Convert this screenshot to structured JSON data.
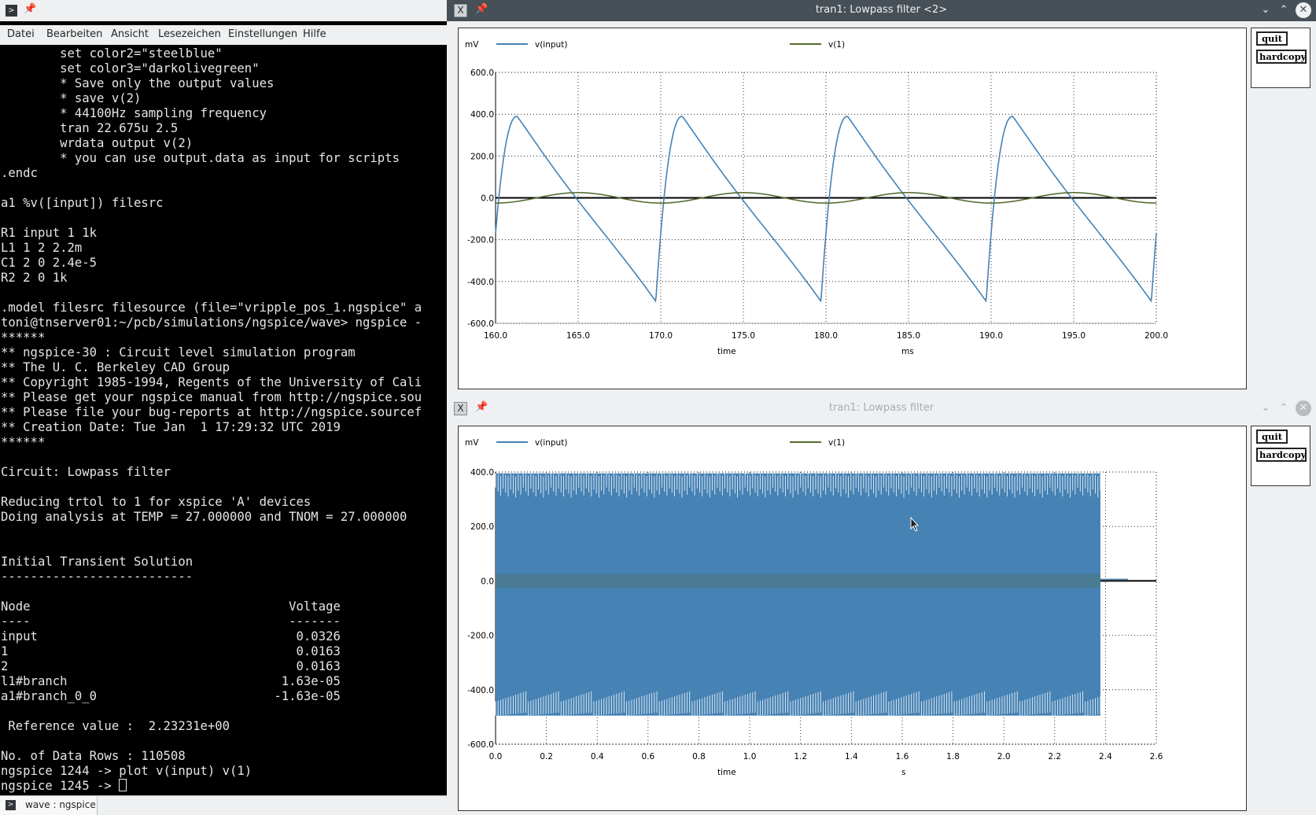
{
  "terminal": {
    "menu": [
      "Datei",
      "Bearbeiten",
      "Ansicht",
      "Lesezeichen",
      "Einstellungen",
      "Hilfe"
    ],
    "lines": [
      "        set color2=\"steelblue\"",
      "        set color3=\"darkolivegreen\"",
      "        * Save only the output values",
      "        * save v(2)",
      "        * 44100Hz sampling frequency",
      "        tran 22.675u 2.5",
      "        wrdata output v(2)",
      "        * you can use output.data as input for scripts",
      ".endc",
      "",
      "a1 %v([input]) filesrc",
      "",
      "R1 input 1 1k",
      "L1 1 2 2.2m",
      "C1 2 0 2.4e-5",
      "R2 2 0 1k",
      "",
      ".model filesrc filesource (file=\"vripple_pos_1.ngspice\" a",
      "toni@tnserver01:~/pcb/simulations/ngspice/wave> ngspice -",
      "******",
      "** ngspice-30 : Circuit level simulation program",
      "** The U. C. Berkeley CAD Group",
      "** Copyright 1985-1994, Regents of the University of Cali",
      "** Please get your ngspice manual from http://ngspice.sou",
      "** Please file your bug-reports at http://ngspice.sourcef",
      "** Creation Date: Tue Jan  1 17:29:32 UTC 2019",
      "******",
      "",
      "Circuit: Lowpass filter",
      "",
      "Reducing trtol to 1 for xspice 'A' devices",
      "Doing analysis at TEMP = 27.000000 and TNOM = 27.000000",
      "",
      "",
      "Initial Transient Solution",
      "--------------------------",
      "",
      "Node                                   Voltage",
      "----                                   -------",
      "input                                   0.0326",
      "1                                       0.0163",
      "2                                       0.0163",
      "l1#branch                             1.63e-05",
      "a1#branch_0_0                        -1.63e-05",
      "",
      " Reference value :  2.23231e+00",
      "",
      "No. of Data Rows : 110508",
      "ngspice 1244 -> plot v(input) v(1)",
      "ngspice 1245 -> "
    ],
    "tab_label": "wave : ngspice"
  },
  "plot1": {
    "title": "tran1: Lowpass filter <2>",
    "buttons": {
      "quit": "quit",
      "hardcopy": "hardcopy"
    },
    "unit": "mV",
    "xlabel": "time",
    "xunit": "ms",
    "legend": [
      "v(input)",
      "v(1)"
    ]
  },
  "plot2": {
    "title": "tran1: Lowpass filter",
    "buttons": {
      "quit": "quit",
      "hardcopy": "hardcopy"
    },
    "unit": "mV",
    "xlabel": "time",
    "xunit": "s",
    "legend": [
      "v(input)",
      "v(1)"
    ]
  },
  "colors": {
    "series1": "#4682b4",
    "series2": "#556b2f",
    "grid": "#000000",
    "titlebar_active": "#475057"
  },
  "chart_data": [
    {
      "type": "line",
      "title": "tran1: Lowpass filter <2>",
      "xlabel": "time",
      "xunit": "ms",
      "ylabel": "",
      "yunit": "mV",
      "xlim": [
        160.0,
        200.0
      ],
      "ylim": [
        -600.0,
        600.0
      ],
      "xticks": [
        "160.0",
        "165.0",
        "170.0",
        "175.0",
        "180.0",
        "185.0",
        "190.0",
        "195.0",
        "200.0"
      ],
      "yticks": [
        "600.0",
        "400.0",
        "200.0",
        "0.0",
        "-200.0",
        "-400.0",
        "-600.0"
      ],
      "grid": true,
      "legend_position": "top",
      "series": [
        {
          "name": "v(input)",
          "color": "#4682b4",
          "shape": "sawtooth",
          "period": 10.0,
          "first_trough": 169.7,
          "rise": 1.6,
          "min": -495,
          "max": 390
        },
        {
          "name": "v(1)",
          "color": "#556b2f",
          "shape": "sine",
          "period": 10.0,
          "amplitude": 25,
          "peak_at": 165.0
        }
      ]
    },
    {
      "type": "line",
      "title": "tran1: Lowpass filter",
      "xlabel": "time",
      "xunit": "s",
      "ylabel": "",
      "yunit": "mV",
      "xlim": [
        0.0,
        2.6
      ],
      "ylim": [
        -600.0,
        400.0
      ],
      "xticks": [
        "0.0",
        "0.2",
        "0.4",
        "0.6",
        "0.8",
        "1.0",
        "1.2",
        "1.4",
        "1.6",
        "1.8",
        "2.0",
        "2.2",
        "2.4",
        "2.6"
      ],
      "yticks": [
        "400.0",
        "200.0",
        "0.0",
        "-200.0",
        "-400.0",
        "-600.0"
      ],
      "grid": true,
      "legend_position": "top",
      "series": [
        {
          "name": "v(input)",
          "color": "#4682b4",
          "min": -495,
          "max": 395,
          "end": 2.38
        },
        {
          "name": "v(1)",
          "color": "#556b2f",
          "min": -25,
          "max": 25,
          "end": 2.38
        }
      ]
    }
  ]
}
